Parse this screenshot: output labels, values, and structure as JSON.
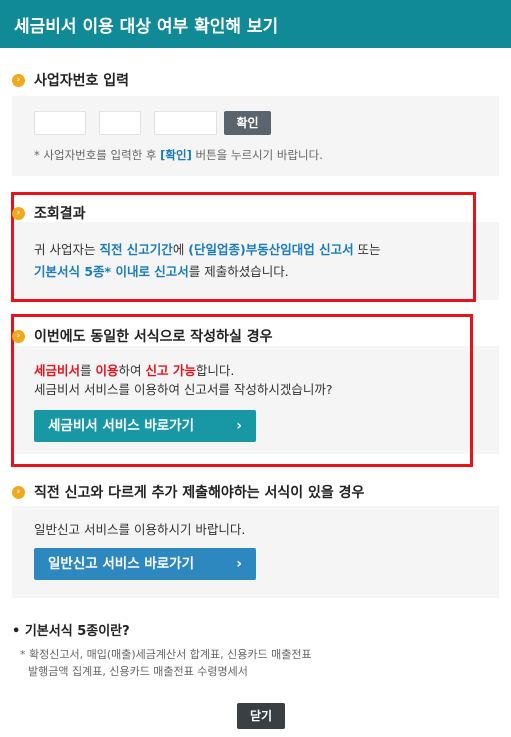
{
  "header": {
    "title": "세금비서 이용 대상 여부 확인해 보기"
  },
  "biz_number": {
    "title": "사업자번호 입력",
    "field1": "",
    "field2": "",
    "field3": "",
    "confirm_label": "확인",
    "note_prefix": "* 사업자번호를 입력한 후 ",
    "note_hl": "[확인]",
    "note_suffix": " 버튼을 누르시기 바랍니다."
  },
  "result": {
    "title": "조회결과",
    "line1_a": "귀 사업자는 ",
    "line1_b": "직전 신고기간",
    "line1_c": "에 ",
    "line1_d": "(단일업종)부동산임대업 신고서",
    "line1_e": " 또는",
    "line2_a": "기본서식 5종* 이내로 신고서",
    "line2_b": "를 제출하셨습니다."
  },
  "same_form": {
    "title": "이번에도 동일한 서식으로 작성하실 경우",
    "line1_a": "세금비서",
    "line1_b": "를 ",
    "line1_c": "이용",
    "line1_d": "하여 ",
    "line1_e": "신고 가능",
    "line1_f": "합니다.",
    "line2": "세금비서 서비스를 이용하여 신고서를 작성하시겠습니까?",
    "button_label": "세금비서 서비스 바로가기"
  },
  "additional": {
    "title": "직전 신고와 다르게 추가 제출해야하는 서식이 있을 경우",
    "line1": "일반신고 서비스를 이용하시기 바랍니다.",
    "button_label": "일반신고 서비스 바로가기"
  },
  "basic_forms": {
    "title": "• 기본서식 5종이란?",
    "line1": "* 확정신고서, 매입(매출)세금계산서 합계표, 신용카드 매출전표",
    "line2": "발행금액 집계표, 신용카드 매출전표 수령명세서"
  },
  "close_label": "닫기",
  "icons": {
    "bullet": "chevron-right-circle-icon",
    "button_arrow": "chevron-right-icon"
  },
  "colors": {
    "header": "#0f8a96",
    "accent_orange": "#f0a81e",
    "highlight_red": "#e8121a",
    "link_blue": "#1a7cb8"
  }
}
